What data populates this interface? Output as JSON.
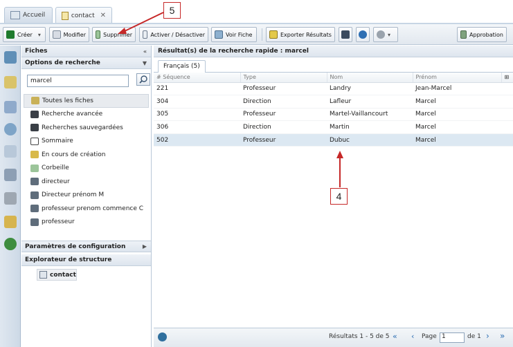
{
  "tabs": [
    {
      "label": "Accueil",
      "active": false
    },
    {
      "label": "contact",
      "active": true,
      "close": "✕"
    }
  ],
  "toolbar": {
    "create": "Créer",
    "modify": "Modifier",
    "delete": "Supprimer",
    "toggle": "Activer / Désactiver",
    "view": "Voir Fiche",
    "export": "Exporter Résultats",
    "approval": "Approbation"
  },
  "left": {
    "fiches": "Fiches",
    "search_options": "Options de recherche",
    "search_value": "marcel",
    "items": [
      {
        "label": "Toutes les fiches",
        "selected": true,
        "icon": "folder-icon"
      },
      {
        "label": "Recherche avancée",
        "icon": "binoculars-icon"
      },
      {
        "label": "Recherches sauvegardées",
        "icon": "binoculars-icon"
      },
      {
        "label": "Sommaire",
        "icon": "sum-icon"
      },
      {
        "label": "En cours de création",
        "icon": "pencil-icon"
      },
      {
        "label": "Corbeille",
        "icon": "trash-icon"
      },
      {
        "label": "directeur",
        "icon": "saved-search-icon"
      },
      {
        "label": "Directeur prénom M",
        "icon": "saved-search-icon"
      },
      {
        "label": "professeur prenom commence C",
        "icon": "saved-search-icon"
      },
      {
        "label": "professeur",
        "icon": "saved-search-icon"
      }
    ],
    "config": "Paramètres de configuration",
    "explorer": "Explorateur de structure",
    "explorer_item": "contact"
  },
  "results": {
    "title": "Résultat(s) de la recherche rapide : marcel",
    "subtab": "Français (5)",
    "columns": [
      "# Séquence",
      "Type",
      "Nom",
      "Prénom"
    ],
    "rows": [
      [
        "221",
        "Professeur",
        "Landry",
        "Jean-Marcel"
      ],
      [
        "304",
        "Direction",
        "Lafleur",
        "Marcel"
      ],
      [
        "305",
        "Professeur",
        "Martel-Vaillancourt",
        "Marcel"
      ],
      [
        "306",
        "Direction",
        "Martin",
        "Marcel"
      ],
      [
        "502",
        "Professeur",
        "Dubuc",
        "Marcel"
      ]
    ],
    "selected_row": 4
  },
  "footer": {
    "results": "Résultats 1 - 5 de 5",
    "page_label": "Page",
    "page_value": "1",
    "of": "de 1"
  },
  "annotations": {
    "a5": "5",
    "a4": "4"
  },
  "colors": {
    "accent": "#c62828",
    "header": "#dde5ee",
    "selected_row": "#dce8f2"
  }
}
